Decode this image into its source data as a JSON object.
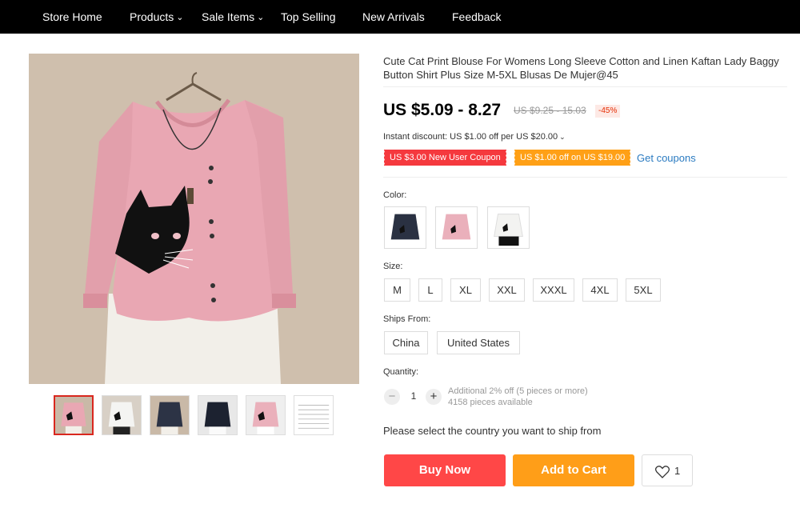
{
  "nav": {
    "items": [
      {
        "label": "Store Home",
        "dropdown": false
      },
      {
        "label": "Products",
        "dropdown": true
      },
      {
        "label": "Sale Items",
        "dropdown": true
      },
      {
        "label": "Top Selling",
        "dropdown": false
      },
      {
        "label": "New Arrivals",
        "dropdown": false
      },
      {
        "label": "Feedback",
        "dropdown": false
      }
    ]
  },
  "product": {
    "title": "Cute Cat Print Blouse For Womens Long Sleeve Cotton and Linen Kaftan Lady Baggy Button Shirt Plus Size M-5XL Blusas De Mujer@45",
    "price": "US $5.09 - 8.27",
    "original_price": "US $9.25 - 15.03",
    "discount": "-45%",
    "instant_discount": "Instant discount: US $1.00 off per US $20.00",
    "coupons": [
      "US $3.00 New User Coupon",
      "US $1.00 off on US $19.00"
    ],
    "get_coupons": "Get coupons"
  },
  "gallery": {
    "thumbnails": [
      "pink",
      "white",
      "navy",
      "black",
      "pink",
      "size-chart"
    ],
    "active_index": 0
  },
  "color": {
    "label": "Color:",
    "options": [
      "navy",
      "pink",
      "white"
    ]
  },
  "size": {
    "label": "Size:",
    "options": [
      "M",
      "L",
      "XL",
      "XXL",
      "XXXL",
      "4XL",
      "5XL"
    ]
  },
  "ships_from": {
    "label": "Ships From:",
    "options": [
      "China",
      "United States"
    ]
  },
  "quantity": {
    "label": "Quantity:",
    "value": "1",
    "note": "Additional 2% off (5 pieces or more)",
    "available": "4158 pieces available"
  },
  "ship_note": "Please select the country you want to ship from",
  "actions": {
    "buy_now": "Buy Now",
    "add_to_cart": "Add to Cart",
    "wishlist_count": "1"
  },
  "colors": {
    "nav_bg": "#000000",
    "buy_now": "#ff4747",
    "add_to_cart": "#ff9e18",
    "coupon_red": "#f5393e",
    "coupon_orange": "#ffa016",
    "link_blue": "#2b7bc1",
    "discount_text": "#e62e04"
  }
}
